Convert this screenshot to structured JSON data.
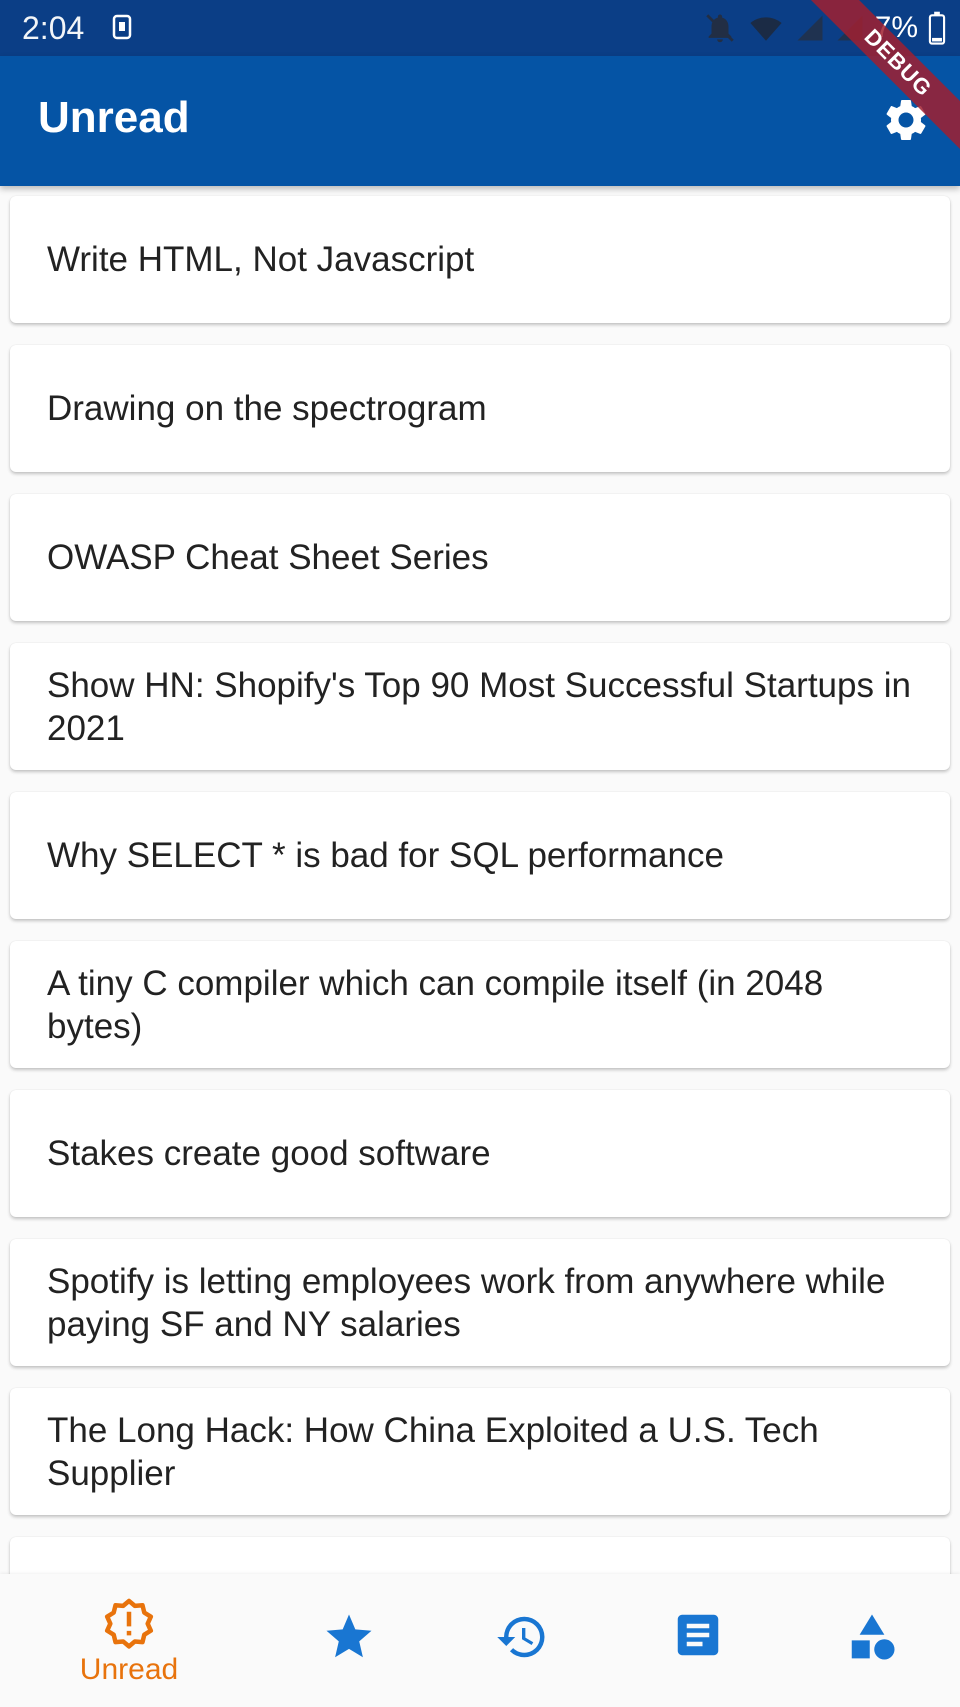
{
  "status_bar": {
    "time": "2:04",
    "battery_text": "7%"
  },
  "app_bar": {
    "title": "Unread",
    "settings_icon": "gear-icon"
  },
  "debug_banner": "DEBUG",
  "articles": [
    {
      "title": "Write HTML, Not Javascript"
    },
    {
      "title": "Drawing on the spectrogram"
    },
    {
      "title": "OWASP Cheat Sheet Series"
    },
    {
      "title": "Show HN: Shopify's Top 90 Most Successful Startups in 2021"
    },
    {
      "title": "Why SELECT * is bad for SQL performance"
    },
    {
      "title": "A tiny C compiler which can compile itself (in 2048 bytes)"
    },
    {
      "title": "Stakes create good software"
    },
    {
      "title": "Spotify is letting employees work from anywhere while paying SF and NY salaries"
    },
    {
      "title": "The Long Hack: How China Exploited a U.S. Tech Supplier"
    },
    {
      "title": ""
    }
  ],
  "bottom_nav": {
    "items": [
      {
        "label": "Unread",
        "icon": "new-releases-icon",
        "active": true
      },
      {
        "label": "",
        "icon": "star-icon",
        "active": false
      },
      {
        "label": "",
        "icon": "history-icon",
        "active": false
      },
      {
        "label": "",
        "icon": "article-icon",
        "active": false
      },
      {
        "label": "",
        "icon": "category-shapes-icon",
        "active": false
      }
    ]
  },
  "colors": {
    "status_bar": "#0b3e86",
    "app_bar": "#0554a5",
    "nav_active": "#e8730c",
    "nav_inactive": "#1976d2",
    "card_text": "#222222"
  }
}
